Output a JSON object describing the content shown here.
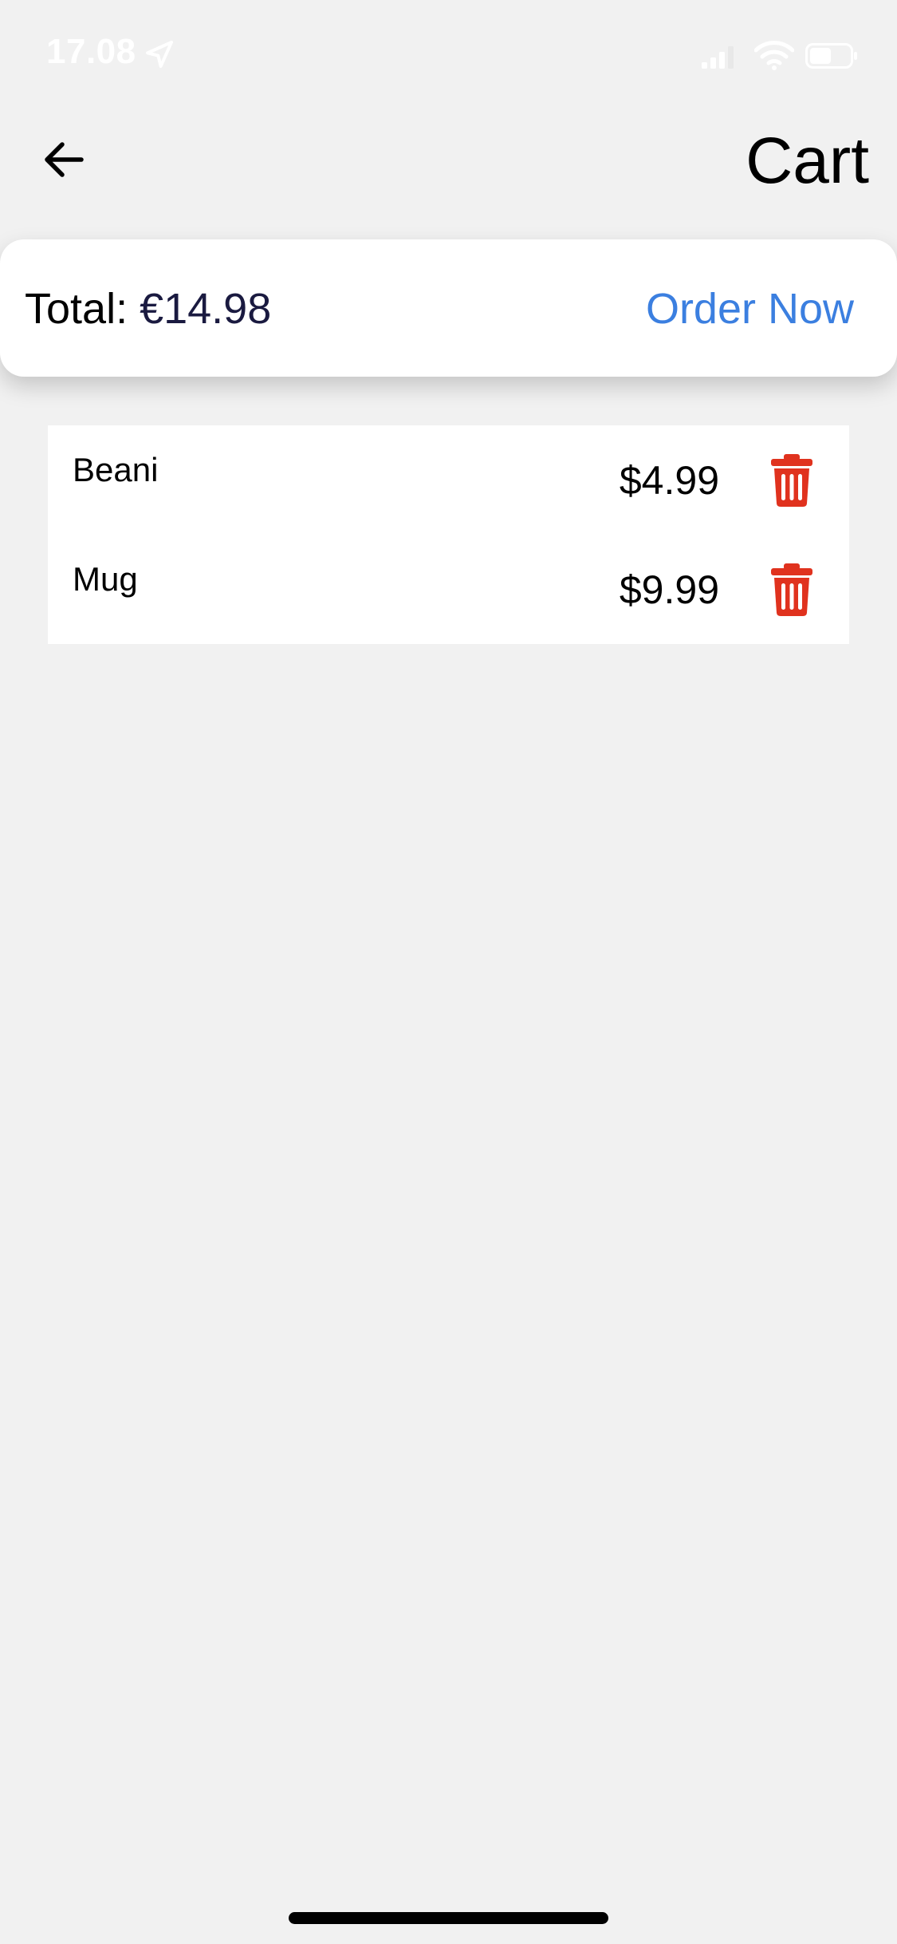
{
  "status_bar": {
    "time": "17.08",
    "location_icon": "location-arrow-icon",
    "signal_icon": "cellular-signal-icon",
    "wifi_icon": "wifi-icon",
    "battery_icon": "battery-icon"
  },
  "header": {
    "back_icon": "arrow-left-icon",
    "title": "Cart"
  },
  "summary": {
    "total_label": "Total: ",
    "total_amount": "€14.98",
    "order_button": "Order Now",
    "order_color": "#3b7fe0"
  },
  "cart": {
    "items": [
      {
        "name": "Beani",
        "price": "$4.99",
        "delete_icon": "trash-icon"
      },
      {
        "name": "Mug",
        "price": "$9.99",
        "delete_icon": "trash-icon"
      }
    ],
    "delete_color": "#e0321e"
  }
}
